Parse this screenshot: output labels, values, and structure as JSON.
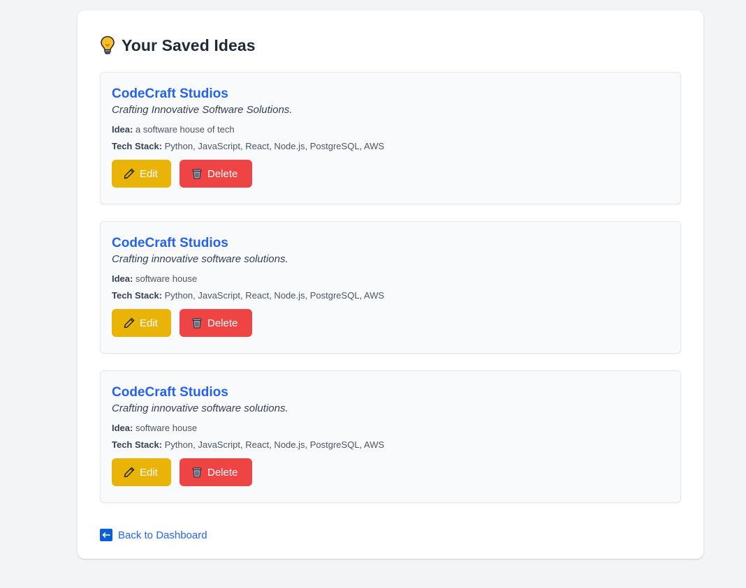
{
  "page": {
    "title": "Your Saved Ideas",
    "title_icon": "lightbulb-icon"
  },
  "ideas": [
    {
      "name": "CodeCraft Studios",
      "tagline": "Crafting Innovative Software Solutions.",
      "idea_label": "Idea:",
      "idea": "a software house of tech",
      "stack_label": "Tech Stack:",
      "stack": "Python, JavaScript, React, Node.js, PostgreSQL, AWS",
      "edit_label": "Edit",
      "delete_label": "Delete"
    },
    {
      "name": "CodeCraft Studios",
      "tagline": "Crafting innovative software solutions.",
      "idea_label": "Idea:",
      "idea": "software house",
      "stack_label": "Tech Stack:",
      "stack": "Python, JavaScript, React, Node.js, PostgreSQL, AWS",
      "edit_label": "Edit",
      "delete_label": "Delete"
    },
    {
      "name": "CodeCraft Studios",
      "tagline": "Crafting innovative software solutions.",
      "idea_label": "Idea:",
      "idea": "software house",
      "stack_label": "Tech Stack:",
      "stack": "Python, JavaScript, React, Node.js, PostgreSQL, AWS",
      "edit_label": "Edit",
      "delete_label": "Delete"
    }
  ],
  "footer": {
    "back_label": "Back to Dashboard",
    "back_icon": "left-arrow-icon"
  },
  "colors": {
    "accent": "#2563eb",
    "edit": "#eab308",
    "delete": "#ef4444",
    "card_bg": "#f9fafb",
    "page_bg": "#f3f4f6"
  }
}
